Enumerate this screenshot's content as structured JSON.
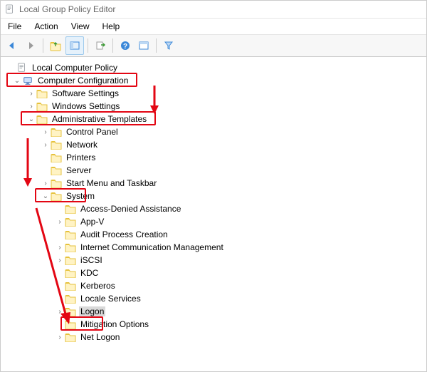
{
  "window": {
    "title": "Local Group Policy Editor"
  },
  "menu": {
    "file": "File",
    "action": "Action",
    "view": "View",
    "help": "Help"
  },
  "tree": {
    "root": {
      "label": "Local Computer Policy"
    },
    "cc": {
      "label": "Computer Configuration"
    },
    "ss": {
      "label": "Software Settings"
    },
    "ws": {
      "label": "Windows Settings"
    },
    "at": {
      "label": "Administrative Templates"
    },
    "cp": {
      "label": "Control Panel"
    },
    "net": {
      "label": "Network"
    },
    "prn": {
      "label": "Printers"
    },
    "srv": {
      "label": "Server"
    },
    "smt": {
      "label": "Start Menu and Taskbar"
    },
    "sys": {
      "label": "System"
    },
    "ada": {
      "label": "Access-Denied Assistance"
    },
    "appv": {
      "label": "App-V"
    },
    "apc": {
      "label": "Audit Process Creation"
    },
    "icm": {
      "label": "Internet Communication Management"
    },
    "iscsi": {
      "label": "iSCSI"
    },
    "kdc": {
      "label": "KDC"
    },
    "krb": {
      "label": "Kerberos"
    },
    "locsvc": {
      "label": "Locale Services"
    },
    "logon": {
      "label": "Logon"
    },
    "mito": {
      "label": "Mitigation Options"
    },
    "netl": {
      "label": "Net Logon"
    }
  },
  "colors": {
    "highlight": "#e30613",
    "selection": "#d9d9d9",
    "folder_light": "#fff3c4",
    "folder_dark": "#e6c23d"
  }
}
